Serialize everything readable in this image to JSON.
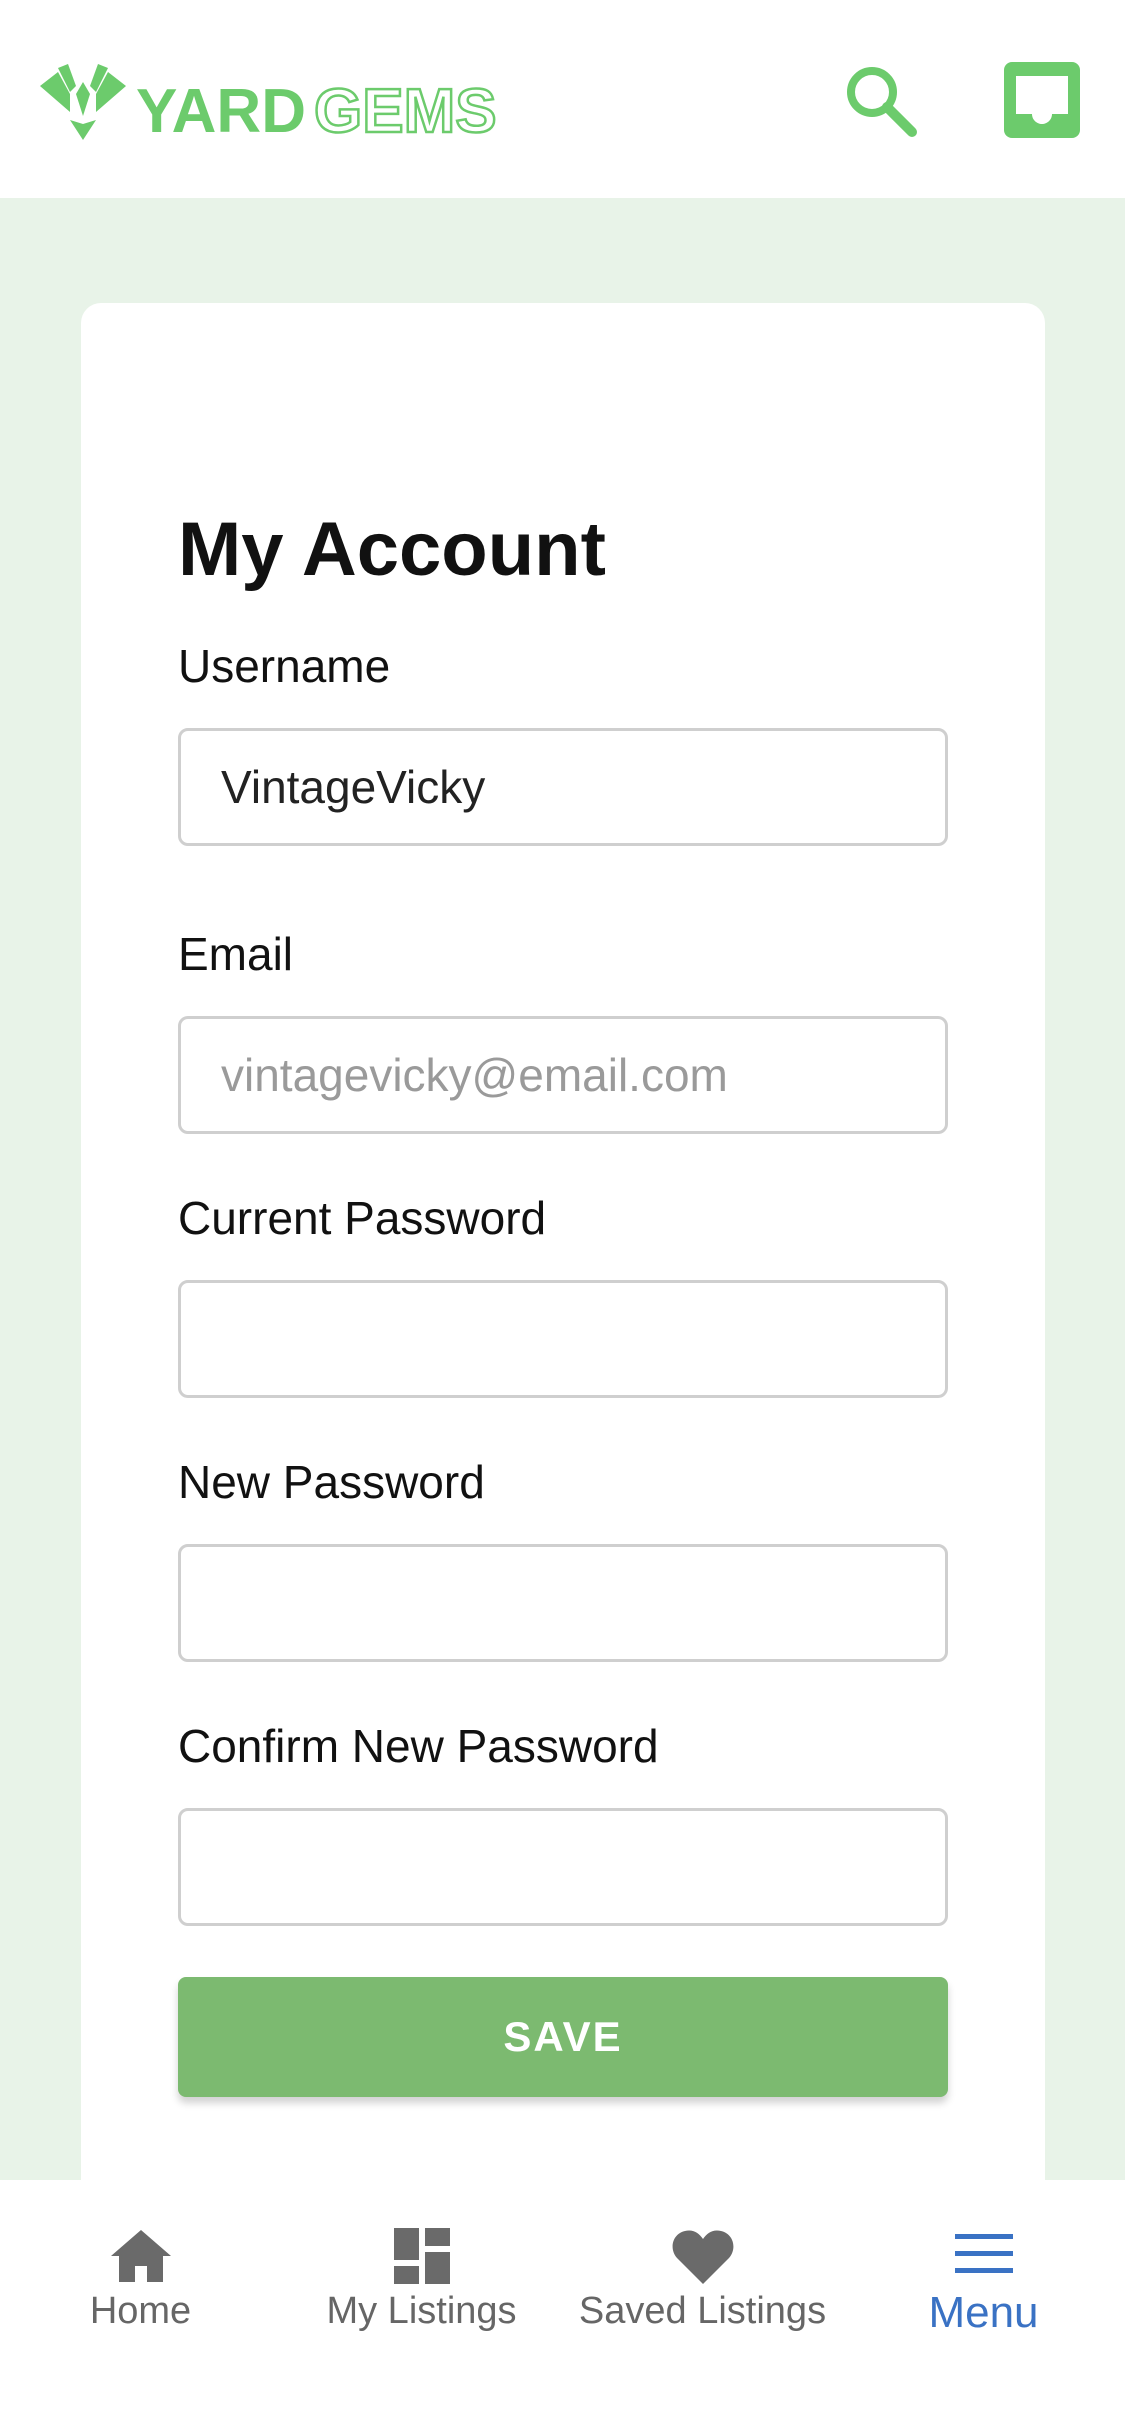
{
  "app": {
    "brand_part1": "YARD",
    "brand_part2": "GEMS"
  },
  "colors": {
    "brand_green": "#6ccb6c",
    "button_green": "#7cba70",
    "page_bg": "#e8f3e8",
    "active_blue": "#3a72c4",
    "inactive_gray": "#666666"
  },
  "header": {
    "search_icon": "search-icon",
    "inbox_icon": "inbox-icon"
  },
  "account": {
    "title": "My Account",
    "fields": {
      "username": {
        "label": "Username",
        "value": "VintageVicky",
        "placeholder": ""
      },
      "email": {
        "label": "Email",
        "value": "",
        "placeholder": "vintagevicky@email.com"
      },
      "current_password": {
        "label": "Current Password",
        "value": "",
        "placeholder": ""
      },
      "new_password": {
        "label": "New Password",
        "value": "",
        "placeholder": ""
      },
      "confirm_password": {
        "label": "Confirm New Password",
        "value": "",
        "placeholder": ""
      }
    },
    "save_label": "SAVE"
  },
  "bottom_nav": {
    "home": {
      "label": "Home",
      "icon": "home-icon"
    },
    "my_listings": {
      "label": "My Listings",
      "icon": "dashboard-icon"
    },
    "saved_listings": {
      "label": "Saved Listings",
      "icon": "heart-icon"
    },
    "menu": {
      "label": "Menu",
      "icon": "hamburger-menu-icon",
      "active": true
    }
  }
}
